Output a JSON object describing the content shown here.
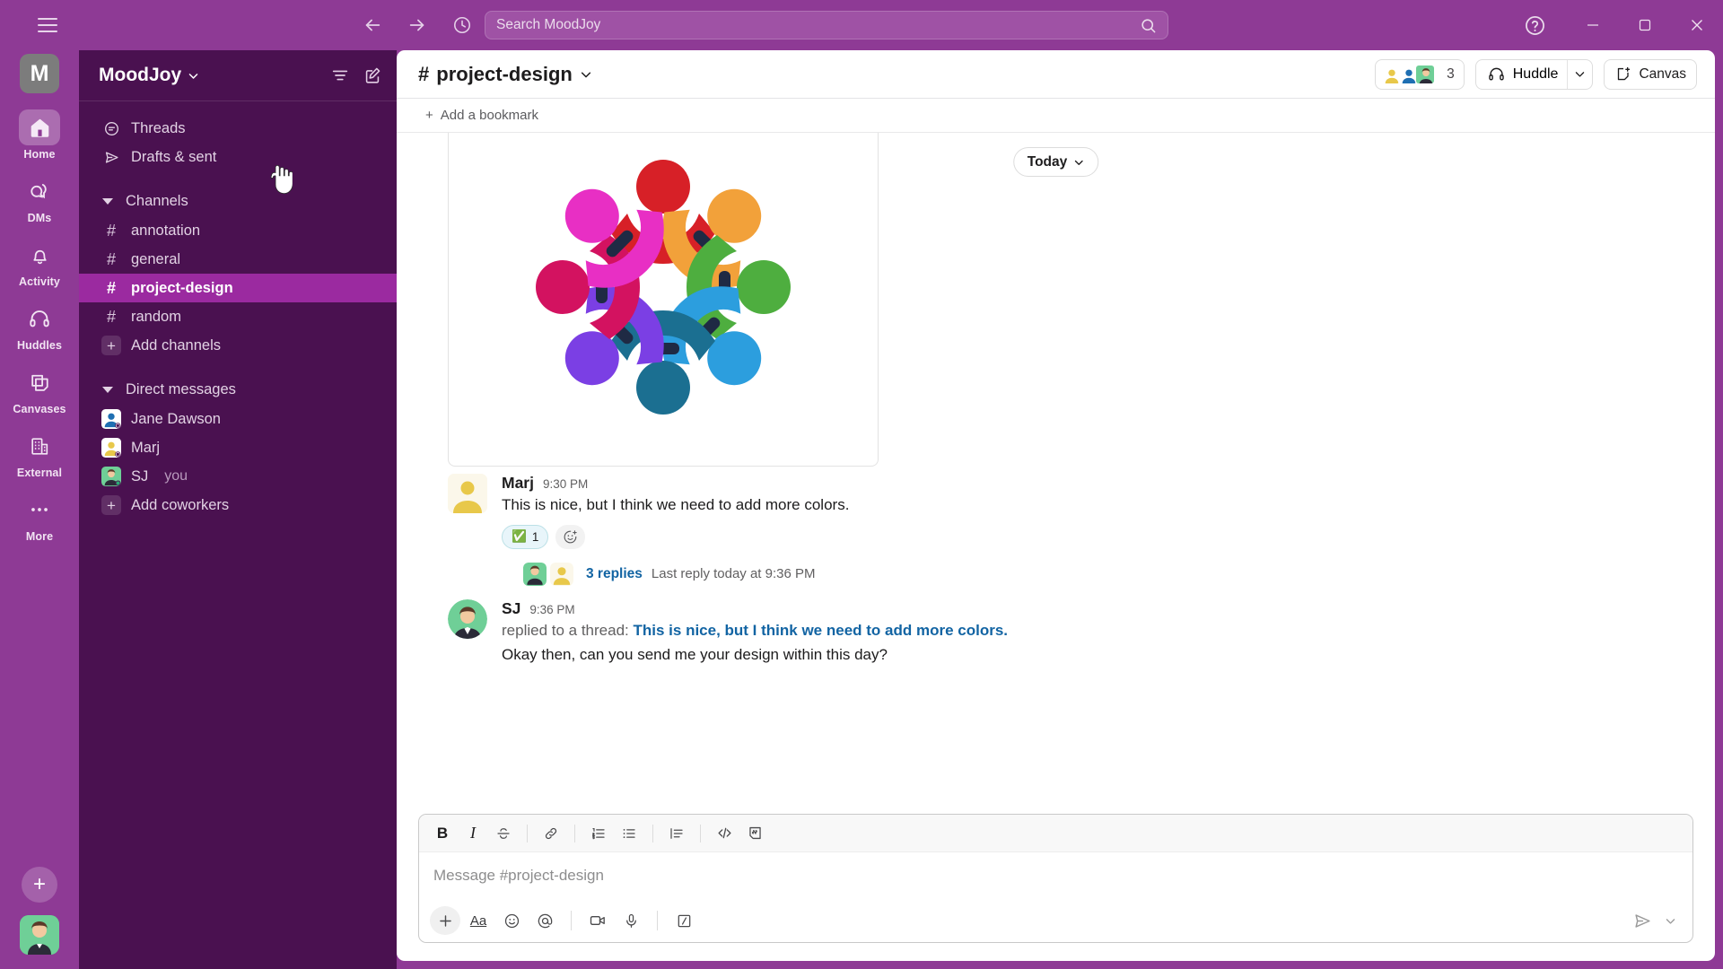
{
  "titlebar": {
    "menu_icon": "hamburger-icon",
    "back_icon": "arrow-left-icon",
    "forward_icon": "arrow-right-icon",
    "history_icon": "clock-icon",
    "search_placeholder": "Search MoodJoy",
    "search_icon": "search-icon",
    "help_icon": "help-circle-icon",
    "minimize_label": "–",
    "maximize_label": "❐",
    "close_label": "✕"
  },
  "rail": {
    "workspace_initial": "M",
    "items": [
      {
        "label": "Home",
        "icon": "home-icon",
        "active": true
      },
      {
        "label": "DMs",
        "icon": "dms-icon",
        "active": false
      },
      {
        "label": "Activity",
        "icon": "bell-icon",
        "active": false
      },
      {
        "label": "Huddles",
        "icon": "headphones-icon",
        "active": false
      },
      {
        "label": "Canvases",
        "icon": "canvas-icon",
        "active": false
      },
      {
        "label": "External",
        "icon": "building-icon",
        "active": false
      },
      {
        "label": "More",
        "icon": "ellipsis-icon",
        "active": false
      }
    ],
    "new_label": "+"
  },
  "sidebar": {
    "workspace_name": "MoodJoy",
    "workspace_caret": "chevron-down-icon",
    "filter_icon": "filter-icon",
    "compose_icon": "compose-icon",
    "quick": [
      {
        "label": "Threads",
        "icon": "threads-icon"
      },
      {
        "label": "Drafts & sent",
        "icon": "send-outline-icon"
      }
    ],
    "channels_section": "Channels",
    "channels": [
      {
        "label": "annotation",
        "selected": false
      },
      {
        "label": "general",
        "selected": false
      },
      {
        "label": "project-design",
        "selected": true
      },
      {
        "label": "random",
        "selected": false
      }
    ],
    "add_channels": "Add channels",
    "dm_section": "Direct messages",
    "dms": [
      {
        "label": "Jane Dawson",
        "you": "",
        "avatar": "blue"
      },
      {
        "label": "Marj",
        "you": "",
        "avatar": "yellow"
      },
      {
        "label": "SJ",
        "you": "you",
        "avatar": "green"
      }
    ],
    "add_coworkers": "Add coworkers"
  },
  "channel": {
    "hash": "#",
    "name": "project-design",
    "caret": "chevron-down-icon",
    "members_count": "3",
    "huddle_label": "Huddle",
    "huddle_icon": "headphones-icon",
    "huddle_caret": "chevron-down-icon",
    "canvas_label": "Canvas",
    "canvas_icon": "canvas-plus-icon",
    "bookmark_label": "Add a bookmark",
    "bookmark_plus": "+"
  },
  "messages": {
    "date_divider": "Today",
    "date_caret": "chevron-down-icon",
    "items": [
      {
        "type": "image",
        "alt": "teamwork-circle-illustration"
      },
      {
        "type": "text",
        "author": "Marj",
        "time": "9:30 PM",
        "text": "This is nice, but I think we need to add more colors.",
        "reaction_emoji": "✅",
        "reaction_count": "1",
        "add_reaction_icon": "emoji-plus-icon",
        "thread_replies": "3 replies",
        "thread_last": "Last reply today at 9:36 PM"
      },
      {
        "type": "thread-reply",
        "author": "SJ",
        "time": "9:36 PM",
        "prefix": "replied to a thread:",
        "quote": "This is nice, but I think we need to add more colors.",
        "text": "Okay then, can you send me your design within this day?"
      }
    ]
  },
  "composer": {
    "placeholder": "Message #project-design",
    "format_buttons": [
      {
        "name": "bold-icon",
        "glyph": "B"
      },
      {
        "name": "italic-icon",
        "glyph": "I"
      },
      {
        "name": "strikethrough-icon",
        "glyph": "S"
      },
      {
        "name": "link-icon",
        "glyph": "link"
      },
      {
        "name": "ordered-list-icon",
        "glyph": "ol"
      },
      {
        "name": "bulleted-list-icon",
        "glyph": "ul"
      },
      {
        "name": "blockquote-icon",
        "glyph": "quote"
      },
      {
        "name": "code-icon",
        "glyph": "</>"
      },
      {
        "name": "code-block-icon",
        "glyph": "codeblock"
      }
    ],
    "action_buttons": [
      {
        "name": "plus-icon"
      },
      {
        "name": "format-text-icon",
        "glyph": "Aa"
      },
      {
        "name": "emoji-icon"
      },
      {
        "name": "mention-icon",
        "glyph": "@"
      },
      {
        "name": "video-icon"
      },
      {
        "name": "microphone-icon"
      },
      {
        "name": "slash-command-icon"
      }
    ],
    "send_icon": "send-icon",
    "send_caret": "chevron-down-icon"
  },
  "colors": {
    "brand_purple": "#8E3A95",
    "sidebar_purple": "#4A1150",
    "selected_channel": "#9B2AA0",
    "link_blue": "#1264A3"
  }
}
